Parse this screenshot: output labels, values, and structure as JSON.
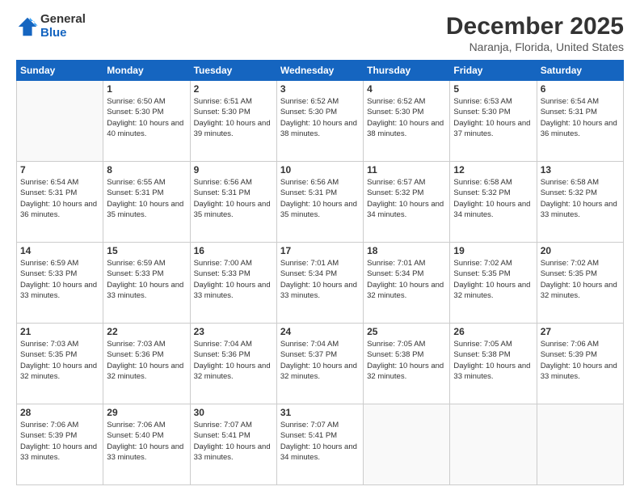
{
  "logo": {
    "general": "General",
    "blue": "Blue"
  },
  "header": {
    "title": "December 2025",
    "subtitle": "Naranja, Florida, United States"
  },
  "weekdays": [
    "Sunday",
    "Monday",
    "Tuesday",
    "Wednesday",
    "Thursday",
    "Friday",
    "Saturday"
  ],
  "weeks": [
    [
      {
        "day": "",
        "sunrise": "",
        "sunset": "",
        "daylight": ""
      },
      {
        "day": "1",
        "sunrise": "Sunrise: 6:50 AM",
        "sunset": "Sunset: 5:30 PM",
        "daylight": "Daylight: 10 hours and 40 minutes."
      },
      {
        "day": "2",
        "sunrise": "Sunrise: 6:51 AM",
        "sunset": "Sunset: 5:30 PM",
        "daylight": "Daylight: 10 hours and 39 minutes."
      },
      {
        "day": "3",
        "sunrise": "Sunrise: 6:52 AM",
        "sunset": "Sunset: 5:30 PM",
        "daylight": "Daylight: 10 hours and 38 minutes."
      },
      {
        "day": "4",
        "sunrise": "Sunrise: 6:52 AM",
        "sunset": "Sunset: 5:30 PM",
        "daylight": "Daylight: 10 hours and 38 minutes."
      },
      {
        "day": "5",
        "sunrise": "Sunrise: 6:53 AM",
        "sunset": "Sunset: 5:30 PM",
        "daylight": "Daylight: 10 hours and 37 minutes."
      },
      {
        "day": "6",
        "sunrise": "Sunrise: 6:54 AM",
        "sunset": "Sunset: 5:31 PM",
        "daylight": "Daylight: 10 hours and 36 minutes."
      }
    ],
    [
      {
        "day": "7",
        "sunrise": "Sunrise: 6:54 AM",
        "sunset": "Sunset: 5:31 PM",
        "daylight": "Daylight: 10 hours and 36 minutes."
      },
      {
        "day": "8",
        "sunrise": "Sunrise: 6:55 AM",
        "sunset": "Sunset: 5:31 PM",
        "daylight": "Daylight: 10 hours and 35 minutes."
      },
      {
        "day": "9",
        "sunrise": "Sunrise: 6:56 AM",
        "sunset": "Sunset: 5:31 PM",
        "daylight": "Daylight: 10 hours and 35 minutes."
      },
      {
        "day": "10",
        "sunrise": "Sunrise: 6:56 AM",
        "sunset": "Sunset: 5:31 PM",
        "daylight": "Daylight: 10 hours and 35 minutes."
      },
      {
        "day": "11",
        "sunrise": "Sunrise: 6:57 AM",
        "sunset": "Sunset: 5:32 PM",
        "daylight": "Daylight: 10 hours and 34 minutes."
      },
      {
        "day": "12",
        "sunrise": "Sunrise: 6:58 AM",
        "sunset": "Sunset: 5:32 PM",
        "daylight": "Daylight: 10 hours and 34 minutes."
      },
      {
        "day": "13",
        "sunrise": "Sunrise: 6:58 AM",
        "sunset": "Sunset: 5:32 PM",
        "daylight": "Daylight: 10 hours and 33 minutes."
      }
    ],
    [
      {
        "day": "14",
        "sunrise": "Sunrise: 6:59 AM",
        "sunset": "Sunset: 5:33 PM",
        "daylight": "Daylight: 10 hours and 33 minutes."
      },
      {
        "day": "15",
        "sunrise": "Sunrise: 6:59 AM",
        "sunset": "Sunset: 5:33 PM",
        "daylight": "Daylight: 10 hours and 33 minutes."
      },
      {
        "day": "16",
        "sunrise": "Sunrise: 7:00 AM",
        "sunset": "Sunset: 5:33 PM",
        "daylight": "Daylight: 10 hours and 33 minutes."
      },
      {
        "day": "17",
        "sunrise": "Sunrise: 7:01 AM",
        "sunset": "Sunset: 5:34 PM",
        "daylight": "Daylight: 10 hours and 33 minutes."
      },
      {
        "day": "18",
        "sunrise": "Sunrise: 7:01 AM",
        "sunset": "Sunset: 5:34 PM",
        "daylight": "Daylight: 10 hours and 32 minutes."
      },
      {
        "day": "19",
        "sunrise": "Sunrise: 7:02 AM",
        "sunset": "Sunset: 5:35 PM",
        "daylight": "Daylight: 10 hours and 32 minutes."
      },
      {
        "day": "20",
        "sunrise": "Sunrise: 7:02 AM",
        "sunset": "Sunset: 5:35 PM",
        "daylight": "Daylight: 10 hours and 32 minutes."
      }
    ],
    [
      {
        "day": "21",
        "sunrise": "Sunrise: 7:03 AM",
        "sunset": "Sunset: 5:35 PM",
        "daylight": "Daylight: 10 hours and 32 minutes."
      },
      {
        "day": "22",
        "sunrise": "Sunrise: 7:03 AM",
        "sunset": "Sunset: 5:36 PM",
        "daylight": "Daylight: 10 hours and 32 minutes."
      },
      {
        "day": "23",
        "sunrise": "Sunrise: 7:04 AM",
        "sunset": "Sunset: 5:36 PM",
        "daylight": "Daylight: 10 hours and 32 minutes."
      },
      {
        "day": "24",
        "sunrise": "Sunrise: 7:04 AM",
        "sunset": "Sunset: 5:37 PM",
        "daylight": "Daylight: 10 hours and 32 minutes."
      },
      {
        "day": "25",
        "sunrise": "Sunrise: 7:05 AM",
        "sunset": "Sunset: 5:38 PM",
        "daylight": "Daylight: 10 hours and 32 minutes."
      },
      {
        "day": "26",
        "sunrise": "Sunrise: 7:05 AM",
        "sunset": "Sunset: 5:38 PM",
        "daylight": "Daylight: 10 hours and 33 minutes."
      },
      {
        "day": "27",
        "sunrise": "Sunrise: 7:06 AM",
        "sunset": "Sunset: 5:39 PM",
        "daylight": "Daylight: 10 hours and 33 minutes."
      }
    ],
    [
      {
        "day": "28",
        "sunrise": "Sunrise: 7:06 AM",
        "sunset": "Sunset: 5:39 PM",
        "daylight": "Daylight: 10 hours and 33 minutes."
      },
      {
        "day": "29",
        "sunrise": "Sunrise: 7:06 AM",
        "sunset": "Sunset: 5:40 PM",
        "daylight": "Daylight: 10 hours and 33 minutes."
      },
      {
        "day": "30",
        "sunrise": "Sunrise: 7:07 AM",
        "sunset": "Sunset: 5:41 PM",
        "daylight": "Daylight: 10 hours and 33 minutes."
      },
      {
        "day": "31",
        "sunrise": "Sunrise: 7:07 AM",
        "sunset": "Sunset: 5:41 PM",
        "daylight": "Daylight: 10 hours and 34 minutes."
      },
      {
        "day": "",
        "sunrise": "",
        "sunset": "",
        "daylight": ""
      },
      {
        "day": "",
        "sunrise": "",
        "sunset": "",
        "daylight": ""
      },
      {
        "day": "",
        "sunrise": "",
        "sunset": "",
        "daylight": ""
      }
    ]
  ]
}
